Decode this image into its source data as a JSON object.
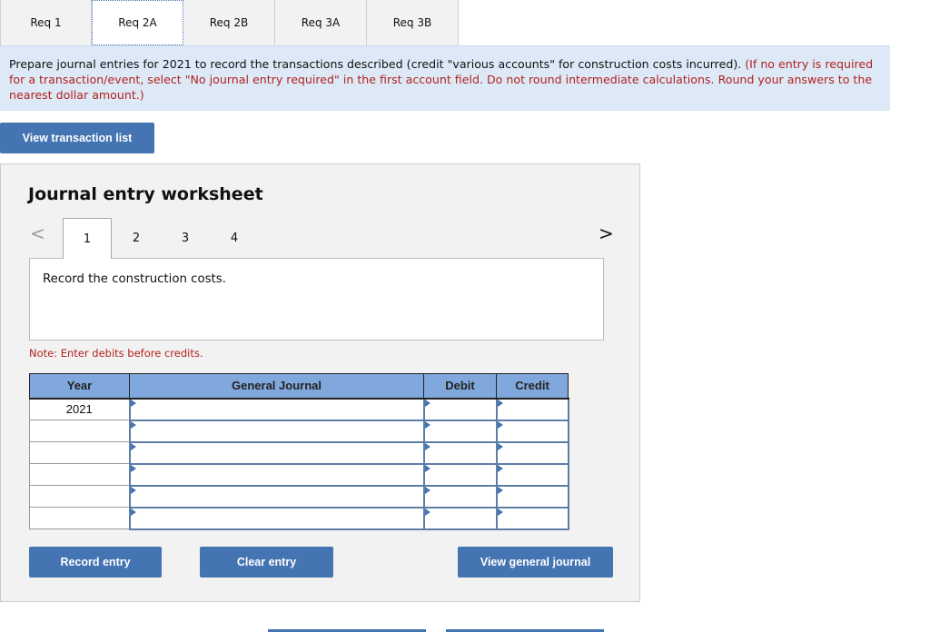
{
  "req_tabs": [
    {
      "label": "Req 1",
      "active": false
    },
    {
      "label": "Req 2A",
      "active": true
    },
    {
      "label": "Req 2B",
      "active": false
    },
    {
      "label": "Req 3A",
      "active": false
    },
    {
      "label": "Req 3B",
      "active": false
    }
  ],
  "instructions": {
    "main": "Prepare journal entries for 2021 to record the transactions described (credit \"various accounts\" for construction costs incurred). ",
    "note": "(If no entry is required for a transaction/event, select \"No journal entry required\" in the first account field. Do not round intermediate calculations. Round your answers to the nearest dollar amount.)"
  },
  "buttons": {
    "view_transaction_list": "View transaction list",
    "record_entry": "Record entry",
    "clear_entry": "Clear entry",
    "view_general_journal": "View general journal"
  },
  "worksheet": {
    "title": "Journal entry worksheet",
    "prev_icon": "<",
    "next_icon": ">",
    "steps": [
      "1",
      "2",
      "3",
      "4"
    ],
    "active_step": "1",
    "description": "Record the construction costs.",
    "note": "Note: Enter debits before credits."
  },
  "journal_table": {
    "headers": {
      "year": "Year",
      "general_journal": "General Journal",
      "debit": "Debit",
      "credit": "Credit"
    },
    "rows": [
      {
        "year": "2021",
        "account": "",
        "debit": "",
        "credit": ""
      },
      {
        "year": "",
        "account": "",
        "debit": "",
        "credit": ""
      },
      {
        "year": "",
        "account": "",
        "debit": "",
        "credit": ""
      },
      {
        "year": "",
        "account": "",
        "debit": "",
        "credit": ""
      },
      {
        "year": "",
        "account": "",
        "debit": "",
        "credit": ""
      },
      {
        "year": "",
        "account": "",
        "debit": "",
        "credit": ""
      }
    ]
  },
  "colors": {
    "accent": "#4474b2",
    "header_blue": "#80a8dc",
    "banner_bg": "#dde9f6",
    "warning_red": "#b2221f"
  }
}
